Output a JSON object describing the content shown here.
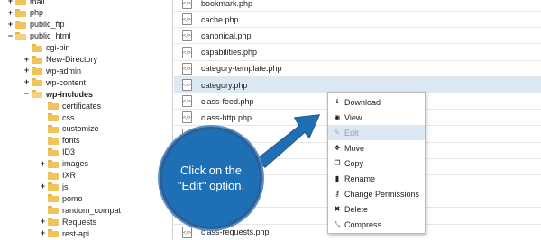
{
  "tree": {
    "items": [
      {
        "label": "mail",
        "toggle": "+",
        "open": false,
        "bold": false
      },
      {
        "label": "php",
        "toggle": "+",
        "open": false,
        "bold": false
      },
      {
        "label": "public_ftp",
        "toggle": "+",
        "open": false,
        "bold": false
      },
      {
        "label": "public_html",
        "toggle": "−",
        "open": true,
        "bold": false
      },
      {
        "label": "cgi-bin",
        "toggle": "",
        "open": false,
        "bold": false
      },
      {
        "label": "New-Directory",
        "toggle": "+",
        "open": false,
        "bold": false
      },
      {
        "label": "wp-admin",
        "toggle": "+",
        "open": false,
        "bold": false
      },
      {
        "label": "wp-content",
        "toggle": "+",
        "open": false,
        "bold": false
      },
      {
        "label": "wp-includes",
        "toggle": "−",
        "open": true,
        "bold": true
      },
      {
        "label": "certificates",
        "toggle": "",
        "open": false,
        "bold": false
      },
      {
        "label": "css",
        "toggle": "",
        "open": false,
        "bold": false
      },
      {
        "label": "customize",
        "toggle": "",
        "open": false,
        "bold": false
      },
      {
        "label": "fonts",
        "toggle": "",
        "open": false,
        "bold": false
      },
      {
        "label": "ID3",
        "toggle": "",
        "open": false,
        "bold": false
      },
      {
        "label": "images",
        "toggle": "+",
        "open": false,
        "bold": false
      },
      {
        "label": "IXR",
        "toggle": "",
        "open": false,
        "bold": false
      },
      {
        "label": "js",
        "toggle": "+",
        "open": false,
        "bold": false
      },
      {
        "label": "pomo",
        "toggle": "",
        "open": false,
        "bold": false
      },
      {
        "label": "random_compat",
        "toggle": "",
        "open": false,
        "bold": false
      },
      {
        "label": "Requests",
        "toggle": "+",
        "open": false,
        "bold": false
      },
      {
        "label": "rest-api",
        "toggle": "+",
        "open": false,
        "bold": false
      }
    ]
  },
  "files": {
    "icon_glyph": "</>",
    "items": [
      {
        "name": "bookmark.php",
        "selected": false
      },
      {
        "name": "cache.php",
        "selected": false
      },
      {
        "name": "canonical.php",
        "selected": false
      },
      {
        "name": "capabilities.php",
        "selected": false
      },
      {
        "name": "category-template.php",
        "selected": false
      },
      {
        "name": "category.php",
        "selected": true
      },
      {
        "name": "class-feed.php",
        "selected": false
      },
      {
        "name": "class-http.php",
        "selected": false
      },
      {
        "name": "",
        "selected": false
      },
      {
        "name": "",
        "selected": false
      },
      {
        "name": "",
        "selected": false
      },
      {
        "name": "",
        "selected": false
      },
      {
        "name": "",
        "selected": false
      },
      {
        "name": "",
        "selected": false
      },
      {
        "name": "class-requests.php",
        "selected": false
      }
    ]
  },
  "context_menu": {
    "items": [
      {
        "label": "Download",
        "icon": "download-icon",
        "glyph": "⭳",
        "highlighted": false
      },
      {
        "label": "View",
        "icon": "eye-icon",
        "glyph": "◉",
        "highlighted": false
      },
      {
        "label": "Edit",
        "icon": "pencil-icon",
        "glyph": "✎",
        "highlighted": true
      },
      {
        "label": "Move",
        "icon": "move-icon",
        "glyph": "✥",
        "highlighted": false
      },
      {
        "label": "Copy",
        "icon": "copy-icon",
        "glyph": "❐",
        "highlighted": false
      },
      {
        "label": "Rename",
        "icon": "file-icon",
        "glyph": "▮",
        "highlighted": false
      },
      {
        "label": "Change Permissions",
        "icon": "key-icon",
        "glyph": "⚷",
        "highlighted": false
      },
      {
        "label": "Delete",
        "icon": "delete-icon",
        "glyph": "✖",
        "highlighted": false
      },
      {
        "label": "Compress",
        "icon": "compress-icon",
        "glyph": "⤡",
        "highlighted": false
      }
    ]
  },
  "callout": {
    "line1": "Click on the",
    "line2": "\"Edit\" option."
  },
  "colors": {
    "callout_fill": "#1f6fb4",
    "selection": "#dce8f4",
    "folder": "#f0c458"
  }
}
